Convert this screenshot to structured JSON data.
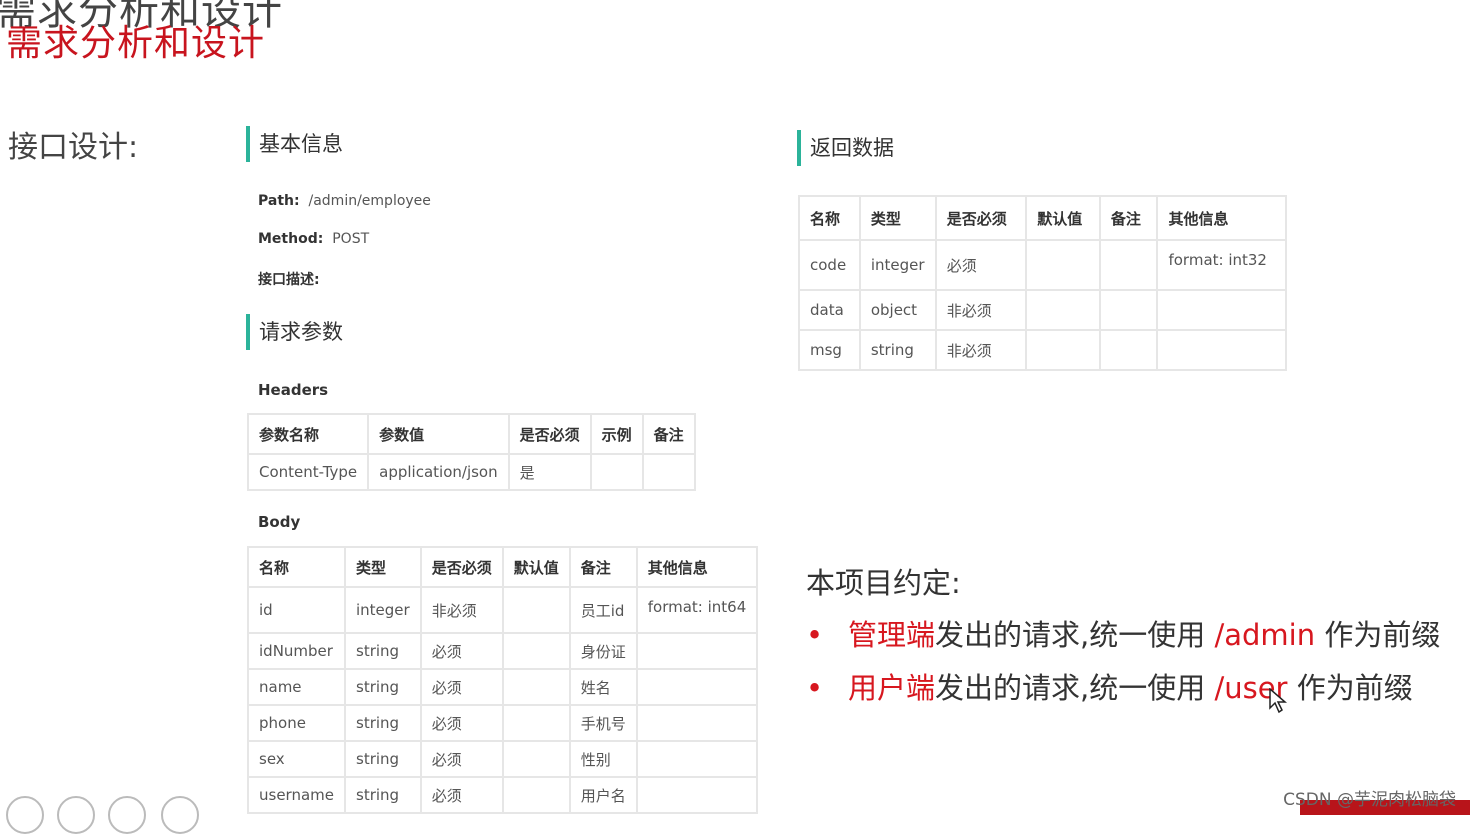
{
  "slide": {
    "title_partial": "需求分析和设计",
    "title": "需求分析和设计",
    "api_design_label": "接口设计:"
  },
  "basic_info": {
    "heading": "基本信息",
    "path_label": "Path:",
    "path_value": "/admin/employee",
    "method_label": "Method:",
    "method_value": "POST",
    "desc_label": "接口描述:"
  },
  "request_params": {
    "heading": "请求参数",
    "headers_label": "Headers",
    "headers_table": {
      "columns": [
        "参数名称",
        "参数值",
        "是否必须",
        "示例",
        "备注"
      ],
      "rows": [
        [
          "Content-Type",
          "application/json",
          "是",
          "",
          ""
        ]
      ]
    },
    "body_label": "Body",
    "body_table": {
      "columns": [
        "名称",
        "类型",
        "是否必须",
        "默认值",
        "备注",
        "其他信息"
      ],
      "rows": [
        [
          "id",
          "integer",
          "非必须",
          "",
          "员工id",
          "format: int64"
        ],
        [
          "idNumber",
          "string",
          "必须",
          "",
          "身份证",
          ""
        ],
        [
          "name",
          "string",
          "必须",
          "",
          "姓名",
          ""
        ],
        [
          "phone",
          "string",
          "必须",
          "",
          "手机号",
          ""
        ],
        [
          "sex",
          "string",
          "必须",
          "",
          "性别",
          ""
        ],
        [
          "username",
          "string",
          "必须",
          "",
          "用户名",
          ""
        ]
      ]
    }
  },
  "response": {
    "heading": "返回数据",
    "table": {
      "columns": [
        "名称",
        "类型",
        "是否必须",
        "默认值",
        "备注",
        "其他信息"
      ],
      "rows": [
        [
          "code",
          "integer",
          "必须",
          "",
          "",
          "format: int32"
        ],
        [
          "data",
          "object",
          "非必须",
          "",
          "",
          ""
        ],
        [
          "msg",
          "string",
          "非必须",
          "",
          "",
          ""
        ]
      ]
    }
  },
  "convention": {
    "title": "本项目约定:",
    "items": [
      {
        "bullet": "•",
        "highlight": "管理端",
        "text1": "发出的请求,统一使用",
        "path": "/admin",
        "text2": "作为前缀"
      },
      {
        "bullet": "•",
        "highlight": "用户端",
        "text1": "发出的请求,统一使用",
        "path": "/user",
        "text2": "作为前缀"
      }
    ]
  },
  "watermark": "CSDN @芋泥肉松脑袋",
  "colors": {
    "title_red": "#c8141e",
    "accent_red": "#d7171f",
    "section_bar": "#2bb39a"
  },
  "icons": [
    "pen-icon",
    "grid-icon",
    "zoom-icon",
    "more-icon",
    "cursor-icon"
  ]
}
